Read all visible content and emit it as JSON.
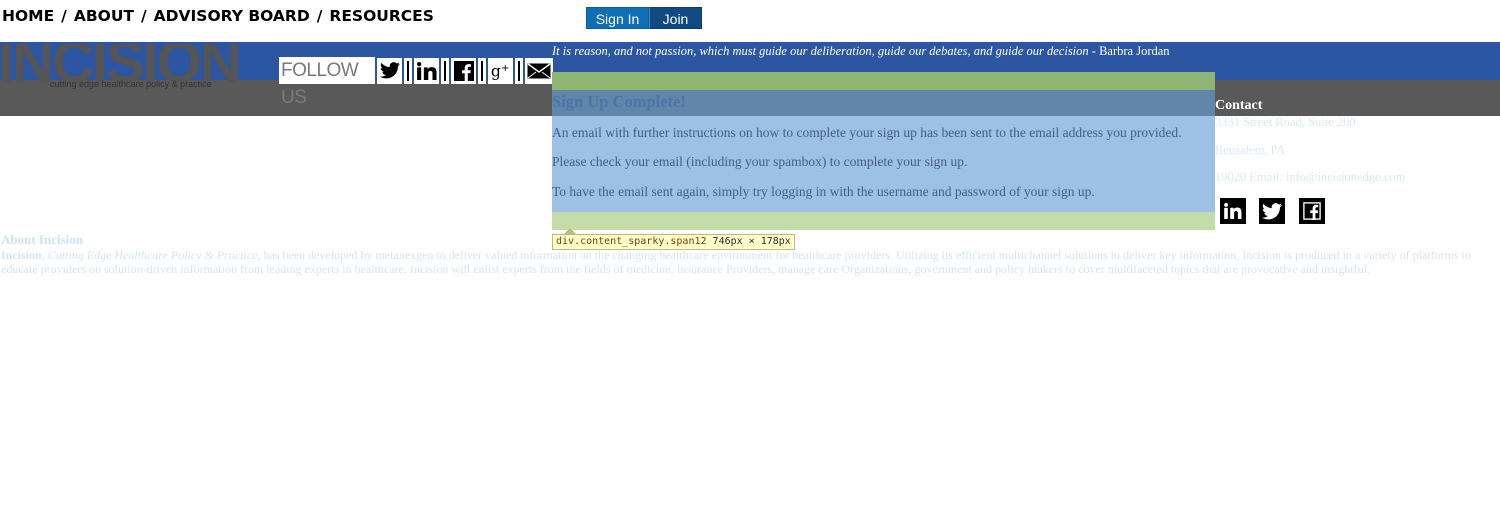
{
  "nav": {
    "items": [
      {
        "label": "HOME"
      },
      {
        "label": "ABOUT"
      },
      {
        "label": "ADVISORY BOARD"
      },
      {
        "label": "RESOURCES"
      }
    ],
    "separator": "/"
  },
  "auth": {
    "signin_label": "Sign In",
    "join_label": "Join"
  },
  "header": {
    "logo_text": "INCISION",
    "logo_tagline": "cutting edge healthcare policy & practice",
    "follow_label": "FOLLOW US",
    "quote": "It is reason, and not passion, which must guide our deliberation, guide our debates, and guide our decision",
    "quote_author": " - Barbra Jordan",
    "colors": {
      "blue_band": "#2c55a2",
      "gray_band": "#595959"
    }
  },
  "follow_icons": [
    "twitter-icon",
    "linkedin-icon",
    "facebook-icon",
    "google-plus-icon",
    "email-icon"
  ],
  "content": {
    "title": "Sign Up Complete!",
    "line1": "An email with further instructions on how to complete your sign up has been sent to the email address you provided.",
    "line2": "Please check your email (including your spambox) to complete your sign up.",
    "line3": "To have the email sent again, simply try logging in with the username and password of your sign up."
  },
  "inspector": {
    "selector": "div.content_sparky.span12",
    "size": "746px × 178px"
  },
  "contact": {
    "title": "Contact",
    "address1": "3331 Street Road, Suite 200",
    "address2": "Bensalem, PA",
    "address3": "19020 Email: info@incisionedge.com",
    "social_icons": [
      "linkedin-icon",
      "twitter-icon",
      "facebook-icon"
    ]
  },
  "about": {
    "title": "About Incision",
    "brand": "Incision",
    "brand_tagline": "Cutting Edge Healthcare Policy & Practice",
    "text": ", has been developed by metanexgen to deliver valued information on the changing healthcare environment for healthcare providers. Utilizing its efficient multichannel solutions to deliver key information, Incision is produced in a variety of platforms to educate providers on solution-driven information from leading experts in healthcare. Incision will enlist experts from the fields of medicine, Insurance Providers, manage care Organizations, government and policy makers to cover multifaceted topics that are provocative and insightful."
  }
}
